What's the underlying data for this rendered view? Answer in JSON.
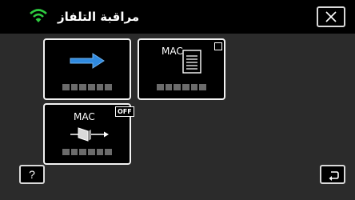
{
  "header": {
    "title": "مراقبة التلفاز",
    "wifi_icon": "wifi-icon",
    "close_icon": "close-icon",
    "accent_color": "#2ecc40"
  },
  "tiles": {
    "send": {
      "icon": "right-arrow-icon",
      "arrow_color": "#2f8ae0"
    },
    "mac_list": {
      "mac_text": "MAC",
      "icon": "document-list-icon",
      "checkbox_checked": false
    },
    "mac_filter": {
      "mac_text": "MAC",
      "badge_text": "OFF",
      "icon": "filter-arrow-icon"
    }
  },
  "footer": {
    "help_label": "?",
    "help_icon": "question-icon",
    "back_icon": "back-return-icon"
  }
}
